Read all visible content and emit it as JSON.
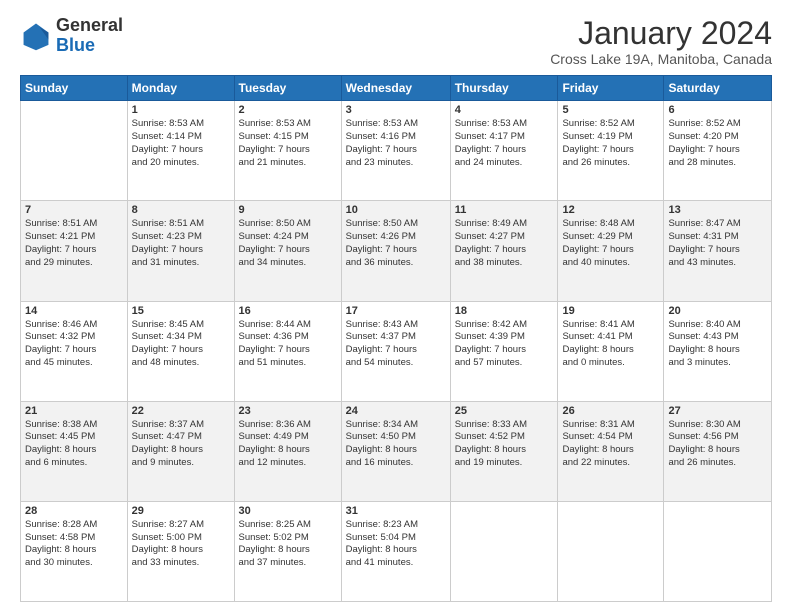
{
  "header": {
    "logo": {
      "general": "General",
      "blue": "Blue"
    },
    "title": "January 2024",
    "location": "Cross Lake 19A, Manitoba, Canada"
  },
  "calendar": {
    "days_of_week": [
      "Sunday",
      "Monday",
      "Tuesday",
      "Wednesday",
      "Thursday",
      "Friday",
      "Saturday"
    ],
    "weeks": [
      [
        {
          "day": "",
          "content": ""
        },
        {
          "day": "1",
          "content": "Sunrise: 8:53 AM\nSunset: 4:14 PM\nDaylight: 7 hours\nand 20 minutes."
        },
        {
          "day": "2",
          "content": "Sunrise: 8:53 AM\nSunset: 4:15 PM\nDaylight: 7 hours\nand 21 minutes."
        },
        {
          "day": "3",
          "content": "Sunrise: 8:53 AM\nSunset: 4:16 PM\nDaylight: 7 hours\nand 23 minutes."
        },
        {
          "day": "4",
          "content": "Sunrise: 8:53 AM\nSunset: 4:17 PM\nDaylight: 7 hours\nand 24 minutes."
        },
        {
          "day": "5",
          "content": "Sunrise: 8:52 AM\nSunset: 4:19 PM\nDaylight: 7 hours\nand 26 minutes."
        },
        {
          "day": "6",
          "content": "Sunrise: 8:52 AM\nSunset: 4:20 PM\nDaylight: 7 hours\nand 28 minutes."
        }
      ],
      [
        {
          "day": "7",
          "content": "Sunrise: 8:51 AM\nSunset: 4:21 PM\nDaylight: 7 hours\nand 29 minutes."
        },
        {
          "day": "8",
          "content": "Sunrise: 8:51 AM\nSunset: 4:23 PM\nDaylight: 7 hours\nand 31 minutes."
        },
        {
          "day": "9",
          "content": "Sunrise: 8:50 AM\nSunset: 4:24 PM\nDaylight: 7 hours\nand 34 minutes."
        },
        {
          "day": "10",
          "content": "Sunrise: 8:50 AM\nSunset: 4:26 PM\nDaylight: 7 hours\nand 36 minutes."
        },
        {
          "day": "11",
          "content": "Sunrise: 8:49 AM\nSunset: 4:27 PM\nDaylight: 7 hours\nand 38 minutes."
        },
        {
          "day": "12",
          "content": "Sunrise: 8:48 AM\nSunset: 4:29 PM\nDaylight: 7 hours\nand 40 minutes."
        },
        {
          "day": "13",
          "content": "Sunrise: 8:47 AM\nSunset: 4:31 PM\nDaylight: 7 hours\nand 43 minutes."
        }
      ],
      [
        {
          "day": "14",
          "content": "Sunrise: 8:46 AM\nSunset: 4:32 PM\nDaylight: 7 hours\nand 45 minutes."
        },
        {
          "day": "15",
          "content": "Sunrise: 8:45 AM\nSunset: 4:34 PM\nDaylight: 7 hours\nand 48 minutes."
        },
        {
          "day": "16",
          "content": "Sunrise: 8:44 AM\nSunset: 4:36 PM\nDaylight: 7 hours\nand 51 minutes."
        },
        {
          "day": "17",
          "content": "Sunrise: 8:43 AM\nSunset: 4:37 PM\nDaylight: 7 hours\nand 54 minutes."
        },
        {
          "day": "18",
          "content": "Sunrise: 8:42 AM\nSunset: 4:39 PM\nDaylight: 7 hours\nand 57 minutes."
        },
        {
          "day": "19",
          "content": "Sunrise: 8:41 AM\nSunset: 4:41 PM\nDaylight: 8 hours\nand 0 minutes."
        },
        {
          "day": "20",
          "content": "Sunrise: 8:40 AM\nSunset: 4:43 PM\nDaylight: 8 hours\nand 3 minutes."
        }
      ],
      [
        {
          "day": "21",
          "content": "Sunrise: 8:38 AM\nSunset: 4:45 PM\nDaylight: 8 hours\nand 6 minutes."
        },
        {
          "day": "22",
          "content": "Sunrise: 8:37 AM\nSunset: 4:47 PM\nDaylight: 8 hours\nand 9 minutes."
        },
        {
          "day": "23",
          "content": "Sunrise: 8:36 AM\nSunset: 4:49 PM\nDaylight: 8 hours\nand 12 minutes."
        },
        {
          "day": "24",
          "content": "Sunrise: 8:34 AM\nSunset: 4:50 PM\nDaylight: 8 hours\nand 16 minutes."
        },
        {
          "day": "25",
          "content": "Sunrise: 8:33 AM\nSunset: 4:52 PM\nDaylight: 8 hours\nand 19 minutes."
        },
        {
          "day": "26",
          "content": "Sunrise: 8:31 AM\nSunset: 4:54 PM\nDaylight: 8 hours\nand 22 minutes."
        },
        {
          "day": "27",
          "content": "Sunrise: 8:30 AM\nSunset: 4:56 PM\nDaylight: 8 hours\nand 26 minutes."
        }
      ],
      [
        {
          "day": "28",
          "content": "Sunrise: 8:28 AM\nSunset: 4:58 PM\nDaylight: 8 hours\nand 30 minutes."
        },
        {
          "day": "29",
          "content": "Sunrise: 8:27 AM\nSunset: 5:00 PM\nDaylight: 8 hours\nand 33 minutes."
        },
        {
          "day": "30",
          "content": "Sunrise: 8:25 AM\nSunset: 5:02 PM\nDaylight: 8 hours\nand 37 minutes."
        },
        {
          "day": "31",
          "content": "Sunrise: 8:23 AM\nSunset: 5:04 PM\nDaylight: 8 hours\nand 41 minutes."
        },
        {
          "day": "",
          "content": ""
        },
        {
          "day": "",
          "content": ""
        },
        {
          "day": "",
          "content": ""
        }
      ]
    ]
  }
}
